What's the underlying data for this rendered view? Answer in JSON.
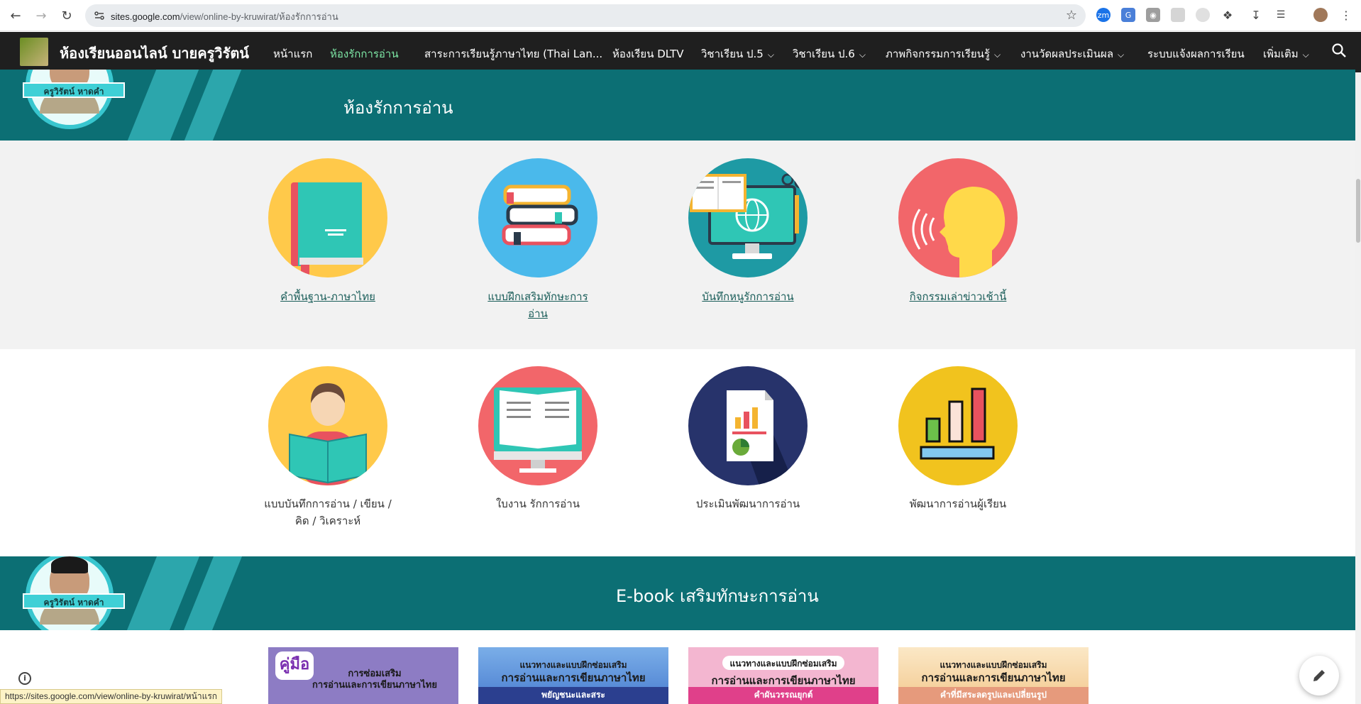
{
  "browser": {
    "url_host": "sites.google.com",
    "url_path": "/view/online-by-kruwirat/ห้องรักการอ่าน",
    "status_url": "https://sites.google.com/view/online-by-kruwirat/หน้าแรก",
    "ext_zm": "zm"
  },
  "site": {
    "title": "ห้องเรียนออนไลน์ บายครูวิรัตน์",
    "menu": [
      {
        "label": "หน้าแรก"
      },
      {
        "label": "ห้องรักการอ่าน"
      },
      {
        "label": "สาระการเรียนรู้ภาษาไทย (Thai Lan..."
      },
      {
        "label": "ห้องเรียน DLTV"
      },
      {
        "label": "วิชาเรียน ป.5"
      },
      {
        "label": "วิชาเรียน ป.6"
      },
      {
        "label": "ภาพกิจกรรมการเรียนรู้"
      },
      {
        "label": "งานวัดผลประเมินผล"
      },
      {
        "label": "ระบบแจ้งผลการเรียน"
      },
      {
        "label": "เพิ่มเติม"
      }
    ],
    "active_menu": "ห้องรักการอ่าน",
    "badge_name": "ครูวิรัตน์  หาดคำ"
  },
  "banner1": {
    "title": "ห้องรักการอ่าน"
  },
  "row1": [
    {
      "label": "คำพื้นฐาน-ภาษาไทย",
      "icon": "book-icon"
    },
    {
      "label": "แบบฝึกเสริมทักษะการอ่าน",
      "icon": "books-stack-icon"
    },
    {
      "label": "บันทึกหนูรักการอ่าน",
      "icon": "computer-globe-icon"
    },
    {
      "label": "กิจกรรมเล่าข่าวเช้านี้",
      "icon": "speaking-head-icon"
    }
  ],
  "row2": [
    {
      "label": "แบบบันทึกการอ่าน / เขียน / คิด / วิเคราะห์",
      "icon": "reader-icon"
    },
    {
      "label": "ใบงาน รักการอ่าน",
      "icon": "open-book-monitor-icon"
    },
    {
      "label": "ประเมินพัฒนาการอ่าน",
      "icon": "report-chart-icon"
    },
    {
      "label": "พัฒนาการอ่านผู้เรียน",
      "icon": "bar-chart-icon"
    }
  ],
  "banner2": {
    "title": "E-book  เสริมทักษะการอ่าน"
  },
  "ebooks": [
    {
      "top": "",
      "title": "การซ่อมเสริม",
      "title2": "การอ่านและการเขียนภาษาไทย",
      "strip": "",
      "bg": "#8d7cc4",
      "strip_bg": "#8d7cc4",
      "badge": "คู่มือ"
    },
    {
      "top": "แนวทางและแบบฝึกซ่อมเสริม",
      "title": "การอ่านและการเขียนภาษาไทย",
      "title2": "",
      "strip": "พยัญชนะและสระ",
      "bg": "#5b93d6",
      "strip_bg": "#2b3f8f",
      "badge": ""
    },
    {
      "top": "แนวทางและแบบฝึกซ่อมเสริม",
      "title": "การอ่านและการเขียนภาษาไทย",
      "title2": "",
      "strip": "คำผันวรรณยุกต์",
      "bg": "#f3b6d0",
      "strip_bg": "#e0408a",
      "badge": ""
    },
    {
      "top": "แนวทางและแบบฝึกซ่อมเสริม",
      "title": "การอ่านและการเขียนภาษาไทย",
      "title2": "",
      "strip": "คำที่มีสระลดรูปและเปลี่ยนรูป",
      "bg": "#f7d9a6",
      "strip_bg": "#e69a7c",
      "badge": ""
    }
  ]
}
